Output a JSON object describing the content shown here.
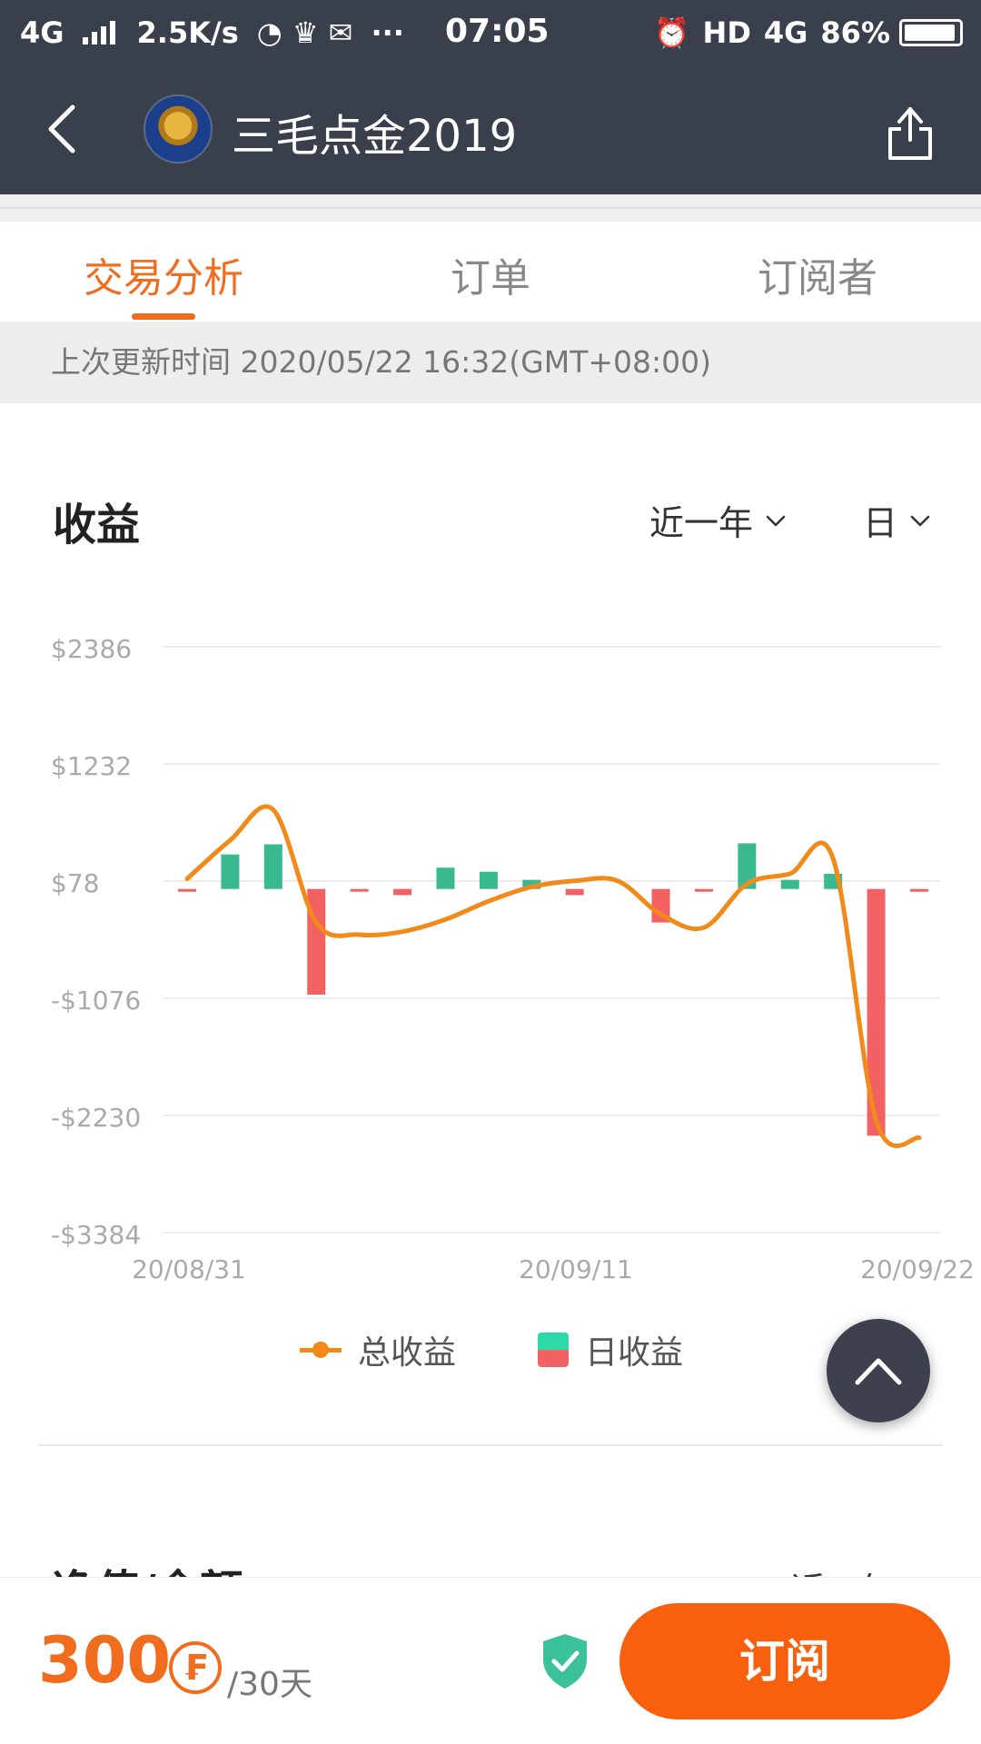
{
  "status_bar": {
    "network": "4G",
    "speed": "2.5K/s",
    "more": "···",
    "time": "07:05",
    "hd": "HD",
    "network_right": "4G",
    "battery": "86%",
    "battery_level": 0.86
  },
  "header": {
    "title": "三毛点金2019",
    "back_icon": "chevron-left-icon",
    "share_icon": "share-icon"
  },
  "tabs": [
    {
      "label": "交易分析",
      "active": true
    },
    {
      "label": "订单",
      "active": false
    },
    {
      "label": "订阅者",
      "active": false
    }
  ],
  "update_text": "上次更新时间 2020/05/22 16:32(GMT+08:00)",
  "profit_section": {
    "title": "收益",
    "range_dropdown": "近一年",
    "granularity_dropdown": "日"
  },
  "chart_data": {
    "type": "bar",
    "title": "收益",
    "y_ticks": [
      "$2386",
      "$1232",
      "$78",
      "-$1076",
      "-$2230",
      "-$3384"
    ],
    "ylim": [
      -3384,
      2386
    ],
    "x_ticks": [
      "20/08/31",
      "20/09/11",
      "20/09/22"
    ],
    "series": [
      {
        "name": "日收益",
        "kind": "bar",
        "colors": {
          "positive": "#38b98f",
          "negative": "#f26263"
        },
        "values": [
          -10,
          340,
          440,
          -1040,
          -10,
          -60,
          210,
          170,
          90,
          -60,
          0,
          -330,
          -20,
          450,
          90,
          150,
          -2430,
          -20
        ]
      },
      {
        "name": "总收益",
        "kind": "line",
        "color": "#f28a1a",
        "values": [
          100,
          480,
          780,
          -330,
          -450,
          -420,
          -300,
          -120,
          20,
          80,
          80,
          -250,
          -380,
          50,
          150,
          300,
          -2280,
          -2450
        ]
      }
    ],
    "legend": [
      {
        "label": "总收益",
        "type": "line"
      },
      {
        "label": "日收益",
        "type": "bar"
      }
    ],
    "grid": true
  },
  "next_section": {
    "title": "净值/余额",
    "dropdown": "近一年"
  },
  "float_button_icon": "chevron-up-icon",
  "bottom_bar": {
    "price": "300",
    "coin_symbol": "₣",
    "period": "/30天",
    "shield_icon": "shield-check-icon",
    "subscribe_label": "订阅"
  }
}
